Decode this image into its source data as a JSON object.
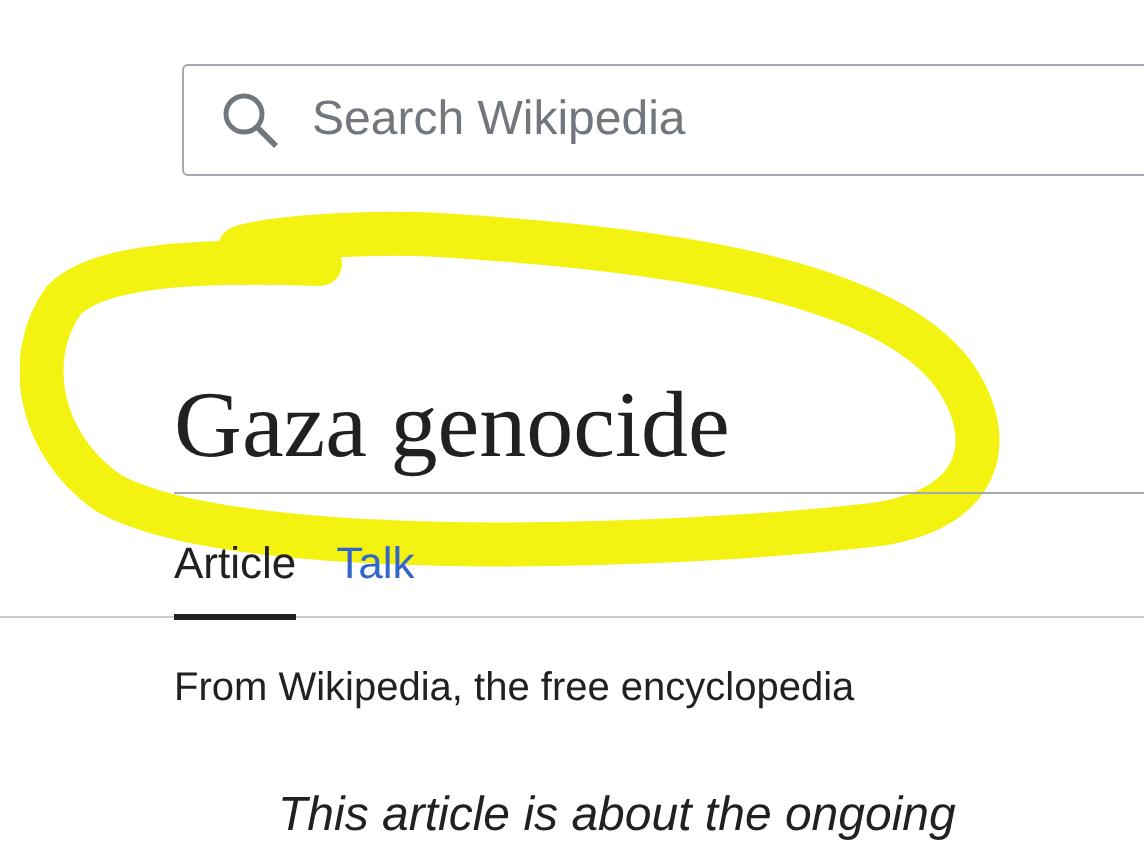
{
  "search": {
    "placeholder": "Search Wikipedia"
  },
  "title": "Gaza genocide",
  "tabs": [
    {
      "label": "Article",
      "selected": true
    },
    {
      "label": "Talk",
      "selected": false
    }
  ],
  "tagline": "From Wikipedia, the free encyclopedia",
  "hatnote": "This article is about the ongoing"
}
